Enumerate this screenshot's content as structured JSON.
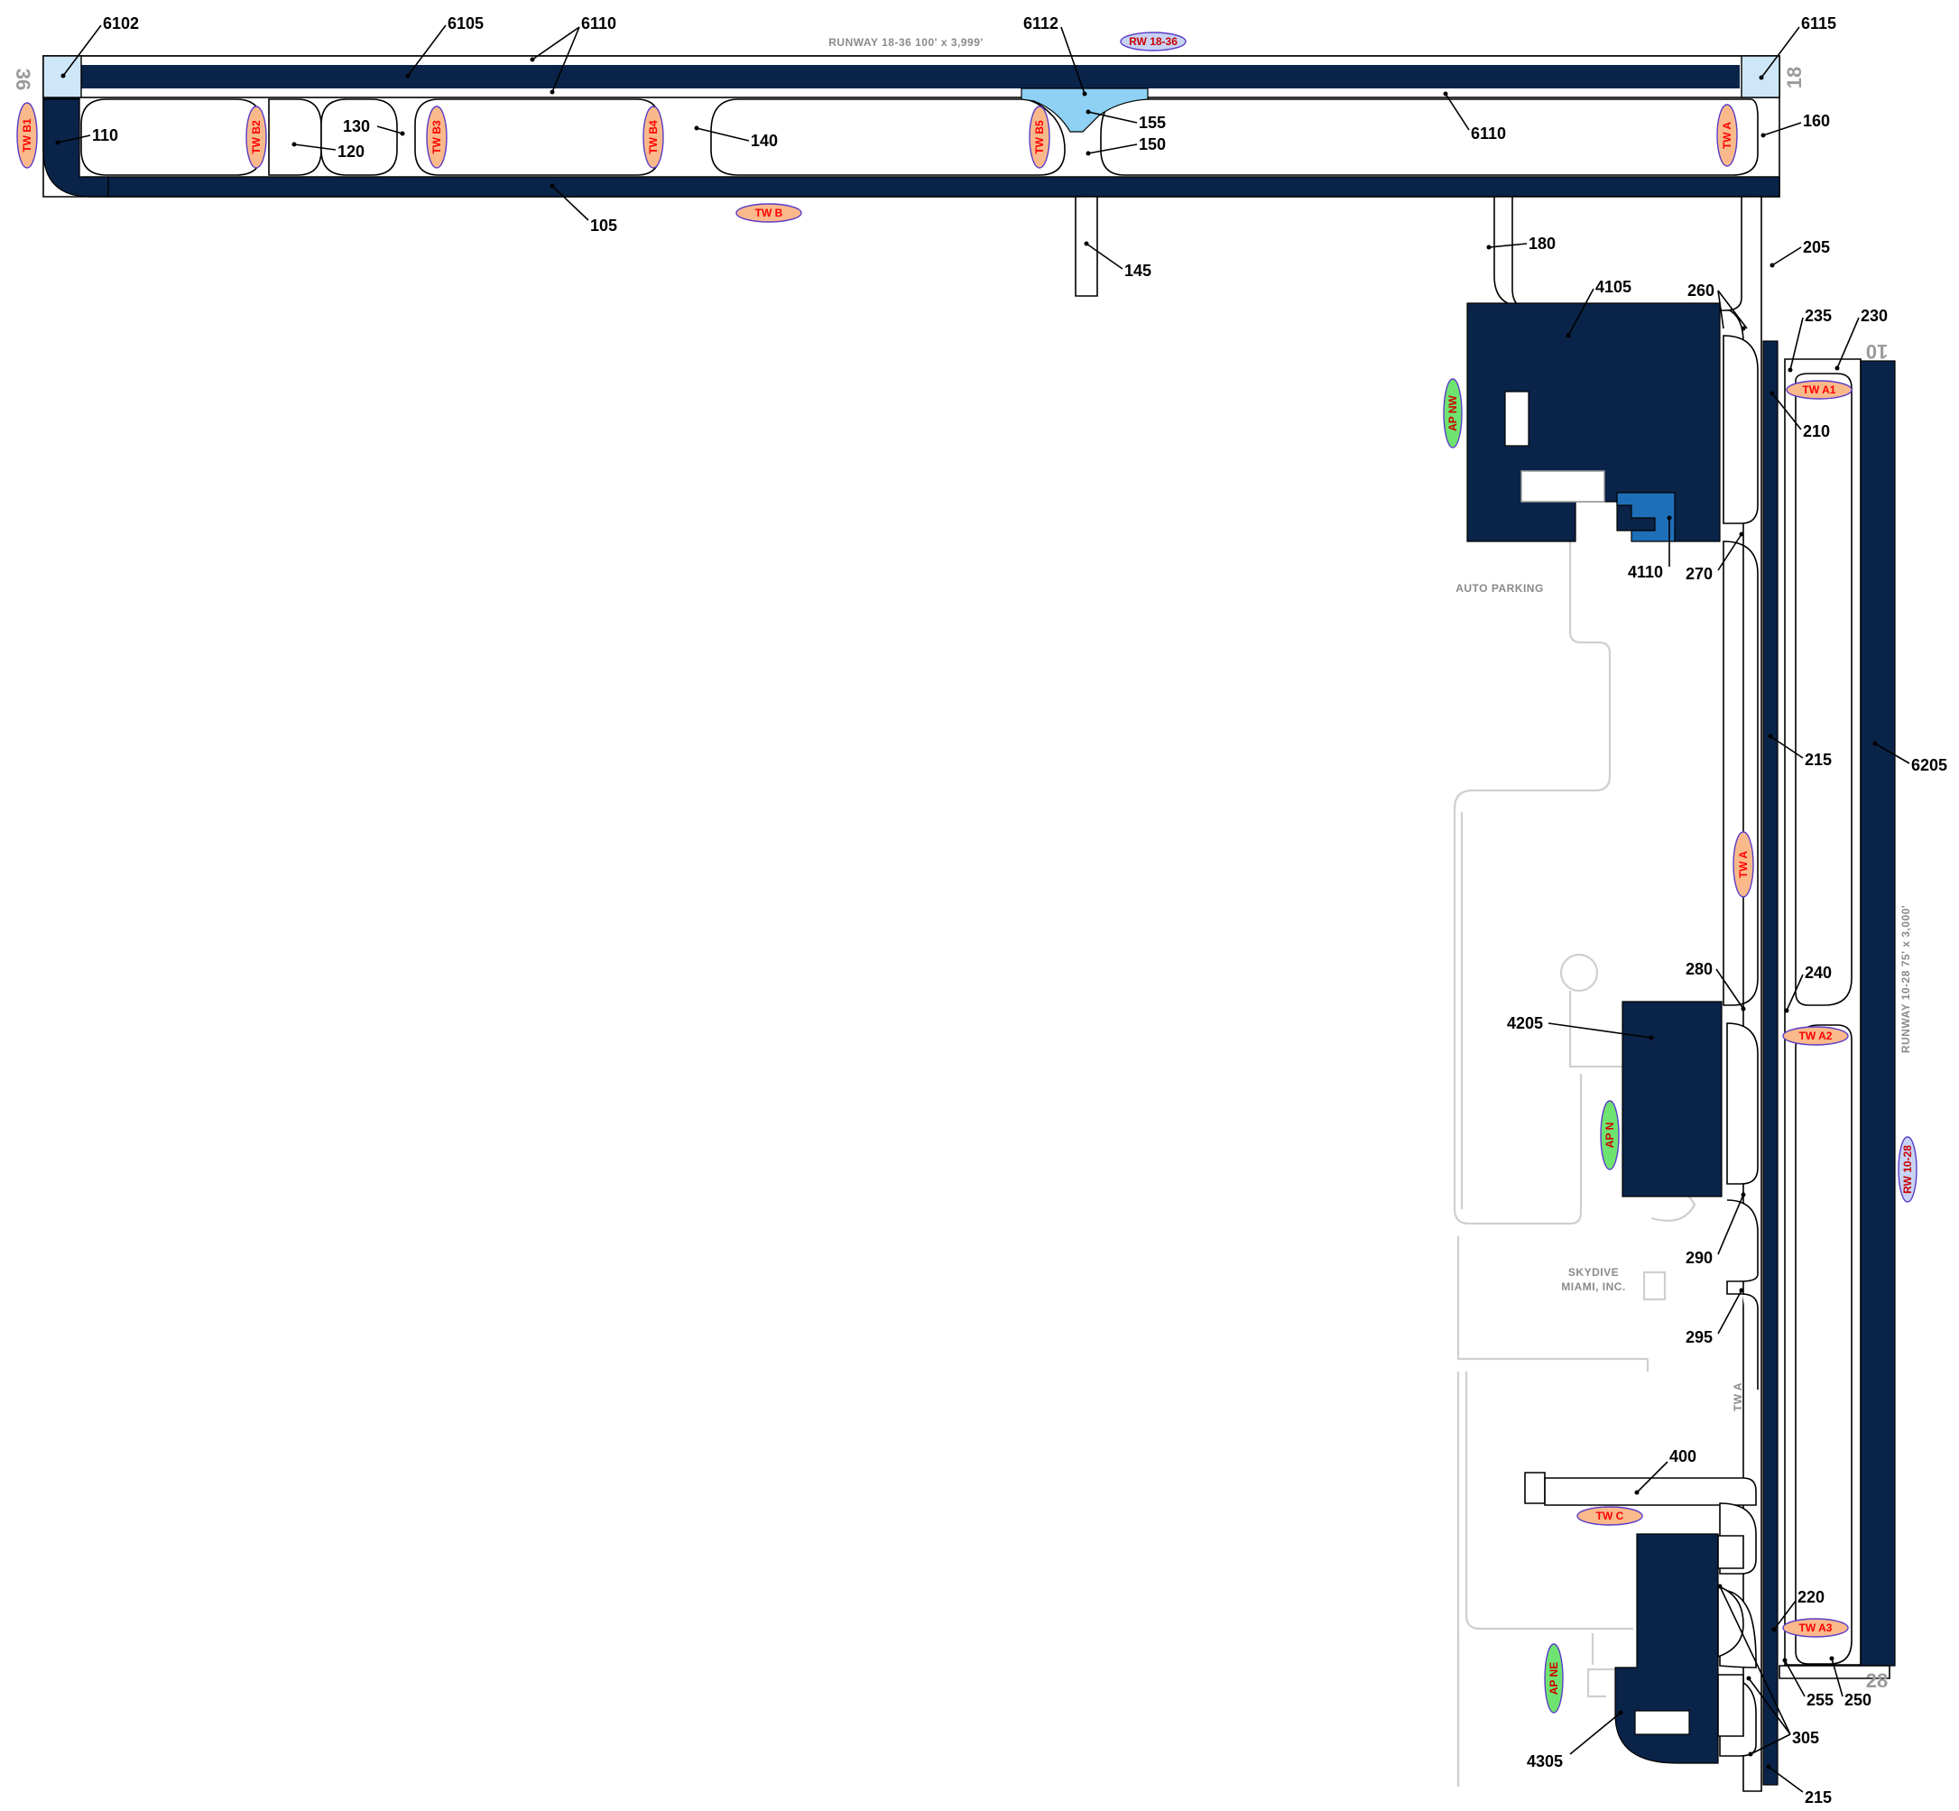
{
  "colors": {
    "dark_pavement": "#0a2348",
    "light_blue_end": "#cde6f8",
    "apron_blue": "#1f6fb8",
    "tw_tag": "#f9b98b",
    "rw_tag": "#c7d3f3",
    "ap_tag": "#6fe36f",
    "tag_text": "#ff0000"
  },
  "text": {
    "runway_1836": "RUNWAY 18-36 100' x 3,999'",
    "runway_1028": "RUNWAY 10-28 75' x 3,000'",
    "auto_parking": "AUTO PARKING",
    "skydive_1": "SKYDIVE",
    "skydive_2": "MIAMI, INC.",
    "tw_a_gray": "TW A",
    "rw_36": "36",
    "rw_18": "18",
    "rw_10": "10",
    "rw_28": "28"
  },
  "tags": {
    "rw_1836": "RW 18-36",
    "rw_1028": "RW 10-28",
    "tw_b": "TW B",
    "tw_b1": "TW B1",
    "tw_b2": "TW B2",
    "tw_b3": "TW B3",
    "tw_b4": "TW B4",
    "tw_b5": "TW B5",
    "tw_a_top": "TW A",
    "tw_a_mid": "TW A",
    "tw_a1": "TW A1",
    "tw_a2": "TW A2",
    "tw_a3": "TW A3",
    "tw_c": "TW C",
    "ap_nw": "AP NW",
    "ap_n": "AP N",
    "ap_ne": "AP NE"
  },
  "callouts": {
    "c6102": "6102",
    "c6105": "6105",
    "c6110a": "6110",
    "c6112": "6112",
    "c6115": "6115",
    "c6110b": "6110",
    "c110": "110",
    "c130": "130",
    "c120": "120",
    "c140": "140",
    "c155": "155",
    "c150": "150",
    "c160": "160",
    "c105": "105",
    "c145": "145",
    "c180": "180",
    "c205": "205",
    "c4105": "4105",
    "c260": "260",
    "c235": "235",
    "c230": "230",
    "c210": "210",
    "c4110": "4110",
    "c270": "270",
    "c215a": "215",
    "c6205": "6205",
    "c280": "280",
    "c240": "240",
    "c4205": "4205",
    "c290": "290",
    "c295": "295",
    "c400": "400",
    "c220": "220",
    "c255": "255",
    "c250": "250",
    "c305": "305",
    "c4305": "4305",
    "c215b": "215"
  }
}
